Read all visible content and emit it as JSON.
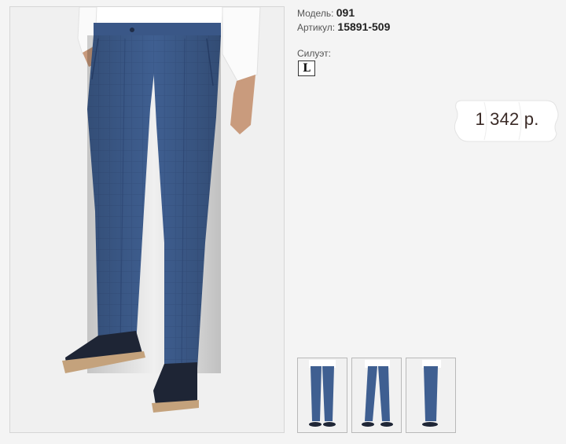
{
  "product": {
    "model_label": "Модель:",
    "model_value": "091",
    "article_label": "Артикул:",
    "article_value": "15891-509",
    "silhouette_label": "Силуэт:",
    "silhouette_value": "L",
    "price": "1 342 р."
  },
  "photos": {
    "main_alt": "navy checked trousers front view",
    "thumbnails": [
      "front view",
      "three-quarter view",
      "side view"
    ]
  },
  "colors": {
    "trousers": "#3f5f91",
    "background": "#f4f4f4",
    "shirt": "#ffffff",
    "shoes": "#1e2535"
  }
}
